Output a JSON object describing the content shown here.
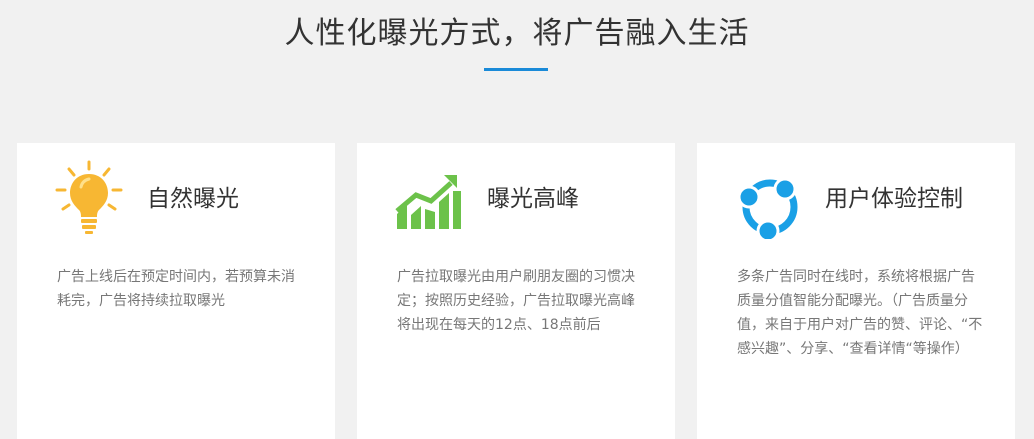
{
  "header": {
    "title": "人性化曝光方式，将广告融入生活"
  },
  "cards": [
    {
      "icon": "lightbulb-icon",
      "title": "自然曝光",
      "description": "广告上线后在预定时间内，若预算未消耗完，广告将持续拉取曝光"
    },
    {
      "icon": "bar-chart-trend-icon",
      "title": "曝光高峰",
      "description": "广告拉取曝光由用户刷朋友圈的习惯决定；按照历史经验，广告拉取曝光高峰将出现在每天的12点、18点前后"
    },
    {
      "icon": "share-nodes-icon",
      "title": "用户体验控制",
      "description": "多条广告同时在线时，系统将根据广告质量分值智能分配曝光。（广告质量分值，来自于用户对广告的赞、评论、“不感兴趣”、分享、“查看详情“等操作）"
    }
  ],
  "colors": {
    "accent": "#1a8ad8",
    "bulb": "#f7b733",
    "chart": "#6cc24a",
    "share": "#1aa0e6"
  }
}
